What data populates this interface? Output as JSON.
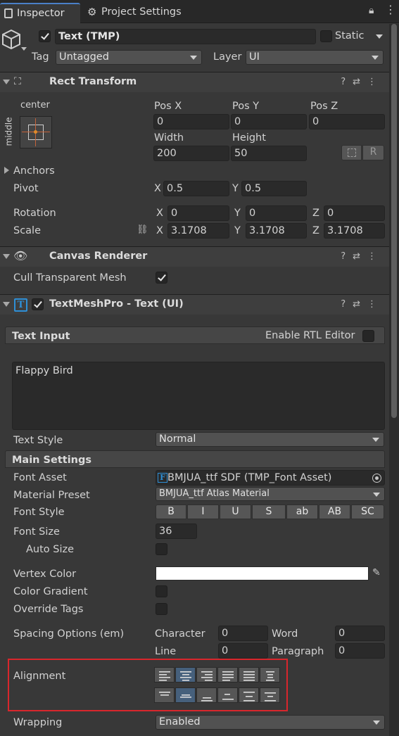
{
  "tabs": [
    {
      "label": "Inspector",
      "active": true
    },
    {
      "label": "Project Settings",
      "active": false
    }
  ],
  "object": {
    "name": "Text (TMP)",
    "active": true,
    "static_label": "Static",
    "tag_label": "Tag",
    "tag_value": "Untagged",
    "layer_label": "Layer",
    "layer_value": "UI"
  },
  "rect_transform": {
    "title": "Rect Transform",
    "anchor_h": "center",
    "anchor_v": "middle",
    "pos_x_label": "Pos X",
    "pos_x": "0",
    "pos_y_label": "Pos Y",
    "pos_y": "0",
    "pos_z_label": "Pos Z",
    "pos_z": "0",
    "width_label": "Width",
    "width": "200",
    "height_label": "Height",
    "height": "50",
    "r_button": "R",
    "anchors_label": "Anchors",
    "pivot_label": "Pivot",
    "pivot_x": "0.5",
    "pivot_y": "0.5",
    "rotation_label": "Rotation",
    "rot_x": "0",
    "rot_y": "0",
    "rot_z": "0",
    "scale_label": "Scale",
    "scale_x": "3.1708",
    "scale_y": "3.1708",
    "scale_z": "3.1708",
    "x": "X",
    "y": "Y",
    "z": "Z"
  },
  "canvas_renderer": {
    "title": "Canvas Renderer",
    "cull_label": "Cull Transparent Mesh",
    "cull_checked": true
  },
  "tmp": {
    "title": "TextMeshPro - Text (UI)",
    "enabled": true,
    "text_input_label": "Text Input",
    "rtl_label": "Enable RTL Editor",
    "text": "Flappy Bird",
    "text_style_label": "Text Style",
    "text_style_value": "Normal",
    "main_settings_label": "Main Settings",
    "font_asset_label": "Font Asset",
    "font_asset_value": "BMJUA_ttf SDF (TMP_Font Asset)",
    "material_preset_label": "Material Preset",
    "material_preset_value": "BMJUA_ttf Atlas Material",
    "font_style_label": "Font Style",
    "font_style_buttons": [
      "B",
      "I",
      "U",
      "S",
      "ab",
      "AB",
      "SC"
    ],
    "font_size_label": "Font Size",
    "font_size_value": "36",
    "auto_size_label": "Auto Size",
    "vertex_color_label": "Vertex Color",
    "vertex_color": "#ffffff",
    "color_gradient_label": "Color Gradient",
    "override_tags_label": "Override Tags",
    "spacing_label": "Spacing Options (em)",
    "character_label": "Character",
    "character_value": "0",
    "word_label": "Word",
    "word_value": "0",
    "line_label": "Line",
    "line_value": "0",
    "paragraph_label": "Paragraph",
    "paragraph_value": "0",
    "alignment_label": "Alignment",
    "wrapping_label": "Wrapping",
    "wrapping_value": "Enabled"
  },
  "colors": {
    "panel_bg": "#383838",
    "selected_button": "#46607c",
    "highlight_box": "#d9262c",
    "accent_tmp_icon": "#2e8fd6"
  }
}
